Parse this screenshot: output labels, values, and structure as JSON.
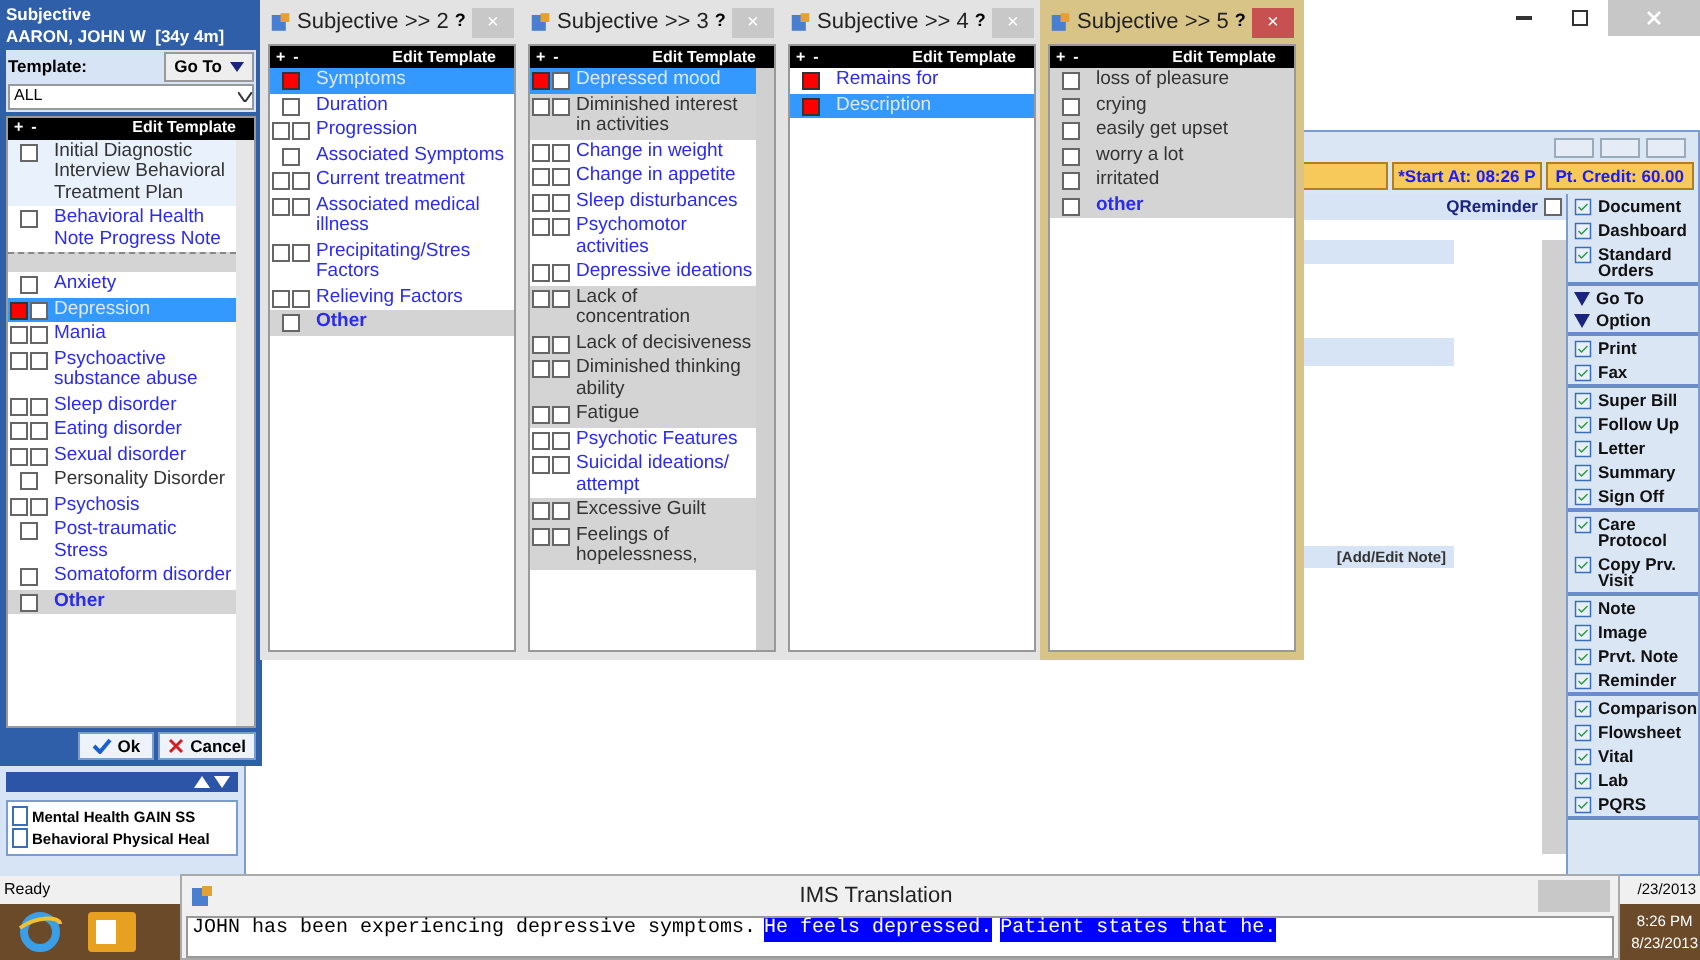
{
  "left": {
    "title": "Subjective",
    "patient": "AARON, JOHN W  [34y 4m]",
    "template_label": "Template:",
    "goto": "Go To",
    "template_value": "ALL",
    "header": {
      "plus": "+",
      "minus": "-",
      "label": "Edit Template"
    },
    "templates": [
      {
        "label": "Initial Diagnostic Interview Behavioral Treatment Plan",
        "link": false,
        "checked": false
      },
      {
        "label": "Behavioral Health Note Progress Note",
        "link": true,
        "checked": false
      }
    ],
    "items": [
      {
        "label": "Anxiety",
        "kind": "single",
        "link": true,
        "bold": false,
        "marked": false,
        "selected": false,
        "shaded": false
      },
      {
        "label": "Depression",
        "kind": "double",
        "link": true,
        "bold": false,
        "marked": true,
        "selected": true,
        "shaded": false
      },
      {
        "label": "Mania",
        "kind": "double",
        "link": true,
        "bold": false,
        "marked": false,
        "selected": false,
        "shaded": false
      },
      {
        "label": "Psychoactive substance abuse",
        "kind": "double",
        "link": true,
        "bold": false,
        "marked": false,
        "selected": false,
        "shaded": false
      },
      {
        "label": "Sleep disorder",
        "kind": "double",
        "link": true,
        "bold": false,
        "marked": false,
        "selected": false,
        "shaded": false
      },
      {
        "label": "Eating disorder",
        "kind": "double",
        "link": true,
        "bold": false,
        "marked": false,
        "selected": false,
        "shaded": false
      },
      {
        "label": "Sexual disorder",
        "kind": "double",
        "link": true,
        "bold": false,
        "marked": false,
        "selected": false,
        "shaded": false
      },
      {
        "label": "Personality Disorder",
        "kind": "single",
        "link": false,
        "bold": false,
        "marked": false,
        "selected": false,
        "shaded": false
      },
      {
        "label": "Psychosis",
        "kind": "double",
        "link": true,
        "bold": false,
        "marked": false,
        "selected": false,
        "shaded": false
      },
      {
        "label": "Post-traumatic Stress",
        "kind": "single",
        "link": true,
        "bold": false,
        "marked": false,
        "selected": false,
        "shaded": false
      },
      {
        "label": "Somatoform disorder",
        "kind": "single",
        "link": true,
        "bold": false,
        "marked": false,
        "selected": false,
        "shaded": false
      },
      {
        "label": "Other",
        "kind": "single",
        "link": true,
        "bold": true,
        "marked": false,
        "selected": false,
        "shaded": true
      }
    ],
    "ok": "Ok",
    "cancel": "Cancel"
  },
  "panels": [
    {
      "title": "Subjective >> 2",
      "help": "?",
      "close": "×",
      "active": false,
      "header": {
        "plus": "+",
        "minus": "-",
        "label": "Edit Template"
      },
      "items": [
        {
          "label": "Symptoms",
          "kind": "single",
          "link": true,
          "bold": false,
          "marked": true,
          "selected": true,
          "shaded": false
        },
        {
          "label": "Duration",
          "kind": "single",
          "link": true,
          "bold": false,
          "marked": false,
          "selected": false,
          "shaded": false
        },
        {
          "label": "Progression",
          "kind": "double",
          "link": true,
          "bold": false,
          "marked": false,
          "selected": false,
          "shaded": false
        },
        {
          "label": "Associated Symptoms",
          "kind": "single",
          "link": true,
          "bold": false,
          "marked": false,
          "selected": false,
          "shaded": false
        },
        {
          "label": "Current treatment",
          "kind": "double",
          "link": true,
          "bold": false,
          "marked": false,
          "selected": false,
          "shaded": false
        },
        {
          "label": "Associated medical illness",
          "kind": "double",
          "link": true,
          "bold": false,
          "marked": false,
          "selected": false,
          "shaded": false
        },
        {
          "label": "Precipitating/Stres Factors",
          "kind": "double",
          "link": true,
          "bold": false,
          "marked": false,
          "selected": false,
          "shaded": false
        },
        {
          "label": "Relieving Factors",
          "kind": "double",
          "link": true,
          "bold": false,
          "marked": false,
          "selected": false,
          "shaded": false
        },
        {
          "label": "Other",
          "kind": "single",
          "link": true,
          "bold": true,
          "marked": false,
          "selected": false,
          "shaded": true
        }
      ]
    },
    {
      "title": "Subjective >> 3",
      "help": "?",
      "close": "×",
      "active": false,
      "header": {
        "plus": "+",
        "minus": "-",
        "label": "Edit Template"
      },
      "items": [
        {
          "label": "Depressed mood",
          "kind": "double",
          "link": true,
          "bold": false,
          "marked": true,
          "selected": true,
          "shaded": false
        },
        {
          "label": "Diminished interest in activities",
          "kind": "double",
          "link": false,
          "bold": false,
          "marked": false,
          "selected": false,
          "shaded": true
        },
        {
          "label": "Change in weight",
          "kind": "double",
          "link": true,
          "bold": false,
          "marked": false,
          "selected": false,
          "shaded": false
        },
        {
          "label": "Change in appetite",
          "kind": "double",
          "link": true,
          "bold": false,
          "marked": false,
          "selected": false,
          "shaded": false
        },
        {
          "label": "Sleep disturbances",
          "kind": "double",
          "link": true,
          "bold": false,
          "marked": false,
          "selected": false,
          "shaded": false
        },
        {
          "label": "Psychomotor activities",
          "kind": "double",
          "link": true,
          "bold": false,
          "marked": false,
          "selected": false,
          "shaded": false
        },
        {
          "label": "Depressive ideations",
          "kind": "double",
          "link": true,
          "bold": false,
          "marked": false,
          "selected": false,
          "shaded": false
        },
        {
          "label": "Lack of concentration",
          "kind": "double",
          "link": false,
          "bold": false,
          "marked": false,
          "selected": false,
          "shaded": true
        },
        {
          "label": "Lack of decisiveness",
          "kind": "double",
          "link": false,
          "bold": false,
          "marked": false,
          "selected": false,
          "shaded": true
        },
        {
          "label": "Diminished thinking ability",
          "kind": "double",
          "link": false,
          "bold": false,
          "marked": false,
          "selected": false,
          "shaded": true
        },
        {
          "label": "Fatigue",
          "kind": "double",
          "link": false,
          "bold": false,
          "marked": false,
          "selected": false,
          "shaded": true
        },
        {
          "label": "Psychotic Features",
          "kind": "double",
          "link": true,
          "bold": false,
          "marked": false,
          "selected": false,
          "shaded": false
        },
        {
          "label": "Suicidal ideations/ attempt",
          "kind": "double",
          "link": true,
          "bold": false,
          "marked": false,
          "selected": false,
          "shaded": false
        },
        {
          "label": "Excessive Guilt",
          "kind": "double",
          "link": false,
          "bold": false,
          "marked": false,
          "selected": false,
          "shaded": true
        },
        {
          "label": "Feelings of hopelessness,",
          "kind": "double",
          "link": false,
          "bold": false,
          "marked": false,
          "selected": false,
          "shaded": true
        }
      ]
    },
    {
      "title": "Subjective >> 4",
      "help": "?",
      "close": "×",
      "active": false,
      "header": {
        "plus": "+",
        "minus": "-",
        "label": "Edit Template"
      },
      "items": [
        {
          "label": "Remains for",
          "kind": "single",
          "link": true,
          "bold": false,
          "marked": true,
          "selected": false,
          "shaded": false
        },
        {
          "label": "Description",
          "kind": "single",
          "link": true,
          "bold": false,
          "marked": true,
          "selected": true,
          "shaded": false
        }
      ]
    },
    {
      "title": "Subjective >> 5",
      "help": "?",
      "close": "×",
      "active": true,
      "header": {
        "plus": "+",
        "minus": "-",
        "label": "Edit Template"
      },
      "items": [
        {
          "label": "loss of pleasure",
          "kind": "single",
          "link": false,
          "bold": false,
          "marked": false,
          "selected": false,
          "shaded": true
        },
        {
          "label": "crying",
          "kind": "single",
          "link": false,
          "bold": false,
          "marked": false,
          "selected": false,
          "shaded": true
        },
        {
          "label": "easily get upset",
          "kind": "single",
          "link": false,
          "bold": false,
          "marked": false,
          "selected": false,
          "shaded": true
        },
        {
          "label": "worry a lot",
          "kind": "single",
          "link": false,
          "bold": false,
          "marked": false,
          "selected": false,
          "shaded": true
        },
        {
          "label": "irritated",
          "kind": "single",
          "link": false,
          "bold": false,
          "marked": false,
          "selected": false,
          "shaded": true
        },
        {
          "label": "other",
          "kind": "single",
          "link": true,
          "bold": true,
          "marked": false,
          "selected": false,
          "shaded": true
        }
      ]
    }
  ],
  "main": {
    "start": "*Start At: 08:26 P",
    "credit": "Pt. Credit: 60.00",
    "qreminder": {
      "label": "QReminder",
      "checked": false
    },
    "add_note": "[Add/Edit Note]",
    "sidebar": [
      [
        {
          "label": "Document",
          "kind": "action"
        },
        {
          "label": "Dashboard",
          "kind": "action"
        },
        {
          "label": "Standard Orders",
          "kind": "action"
        }
      ],
      [
        {
          "label": "Go To",
          "kind": "menu"
        },
        {
          "label": "Option",
          "kind": "menu"
        }
      ],
      [
        {
          "label": "Print",
          "kind": "action"
        },
        {
          "label": "Fax",
          "kind": "action"
        }
      ],
      [
        {
          "label": "Super Bill",
          "kind": "action"
        },
        {
          "label": "Follow Up",
          "kind": "action"
        },
        {
          "label": "Letter",
          "kind": "action"
        },
        {
          "label": "Summary",
          "kind": "action"
        },
        {
          "label": "Sign Off",
          "kind": "action"
        }
      ],
      [
        {
          "label": "Care Protocol",
          "kind": "action"
        },
        {
          "label": "Copy Prv. Visit",
          "kind": "action"
        }
      ],
      [
        {
          "label": "Note",
          "kind": "action"
        },
        {
          "label": "Image",
          "kind": "action"
        },
        {
          "label": "Prvt. Note",
          "kind": "action"
        },
        {
          "label": "Reminder",
          "kind": "action"
        }
      ],
      [
        {
          "label": "Comparison",
          "kind": "action"
        },
        {
          "label": "Flowsheet",
          "kind": "action"
        },
        {
          "label": "Vital",
          "kind": "action"
        },
        {
          "label": "Lab",
          "kind": "action"
        },
        {
          "label": "PQRS",
          "kind": "action"
        }
      ]
    ],
    "documents": [
      "Mental Health GAIN SS",
      "Behavioral Physical Heal"
    ]
  },
  "status_bar": {
    "text": "Ready",
    "date": "/23/2013"
  },
  "translation": {
    "title": "IMS Translation",
    "segments": [
      {
        "text": "JOHN has been experiencing depressive symptoms.",
        "highlighted": false
      },
      {
        "text": "He feels depressed.",
        "highlighted": true
      },
      {
        "text": "Patient states that he.",
        "highlighted": true
      }
    ]
  },
  "taskbar": {
    "time": "8:26 PM",
    "date": "8/23/2013"
  }
}
